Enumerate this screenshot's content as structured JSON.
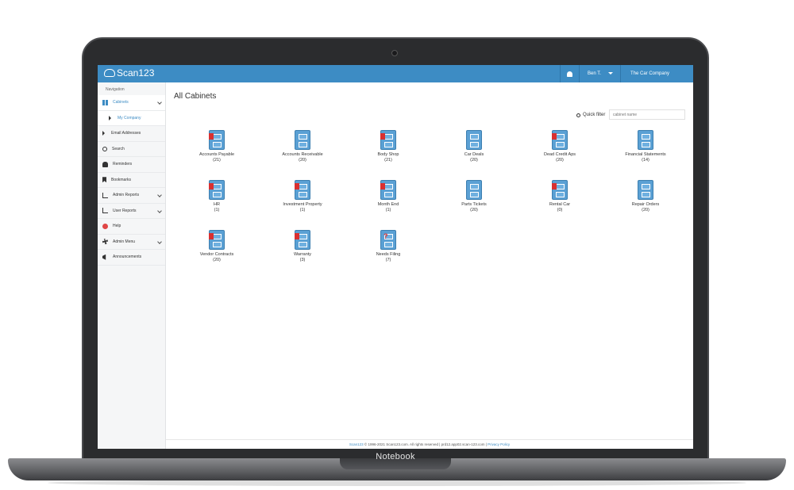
{
  "device": {
    "base_label": "Notebook"
  },
  "header": {
    "logo": "Scan123",
    "user": "Ben T.",
    "company": "The Car Company"
  },
  "sidebar": {
    "heading": "Navigation",
    "items": [
      {
        "label": "Cabinets",
        "icon": "grid-icon"
      },
      {
        "label": "My Company",
        "icon": "caret-right-icon"
      },
      {
        "label": "Email Addresses",
        "icon": "caret-right-icon"
      },
      {
        "label": "Search",
        "icon": "search-icon"
      },
      {
        "label": "Reminders",
        "icon": "bell-icon"
      },
      {
        "label": "Bookmarks",
        "icon": "bookmark-icon"
      },
      {
        "label": "Admin Reports",
        "icon": "chart-icon"
      },
      {
        "label": "User Reports",
        "icon": "chart-icon"
      },
      {
        "label": "Help",
        "icon": "help-icon"
      },
      {
        "label": "Admin Menu",
        "icon": "gear-icon"
      },
      {
        "label": "Announcements",
        "icon": "megaphone-icon"
      }
    ]
  },
  "main": {
    "title": "All Cabinets",
    "quick_filter_label": "Quick filter",
    "quick_filter_placeholder": "cabinet name",
    "cabinets": [
      {
        "name": "Accounts Payable",
        "count": "(21)"
      },
      {
        "name": "Accounts Receivable",
        "count": "(20)"
      },
      {
        "name": "Body Shop",
        "count": "(21)"
      },
      {
        "name": "Car Deals",
        "count": "(20)"
      },
      {
        "name": "Dead Credit Aps",
        "count": "(20)"
      },
      {
        "name": "Financial Statements",
        "count": "(14)"
      },
      {
        "name": "HR",
        "count": "(1)"
      },
      {
        "name": "Investment Property",
        "count": "(1)"
      },
      {
        "name": "Month End",
        "count": "(1)"
      },
      {
        "name": "Parts Tickets",
        "count": "(20)"
      },
      {
        "name": "Rental Car",
        "count": "(0)"
      },
      {
        "name": "Repair Orders",
        "count": "(20)"
      },
      {
        "name": "Vendor Contracts",
        "count": "(20)"
      },
      {
        "name": "Warranty",
        "count": "(3)"
      },
      {
        "name": "Needs Filing",
        "count": "(7)"
      }
    ]
  },
  "footer": {
    "brand": "Scan123",
    "text": " © 1996-2021 Scan123.com. All rights reserved | prd12.app02.scan-123.com | ",
    "privacy": "Privacy Policy"
  },
  "colors": {
    "accent": "#3d8cc4",
    "flag": "#d93030"
  }
}
